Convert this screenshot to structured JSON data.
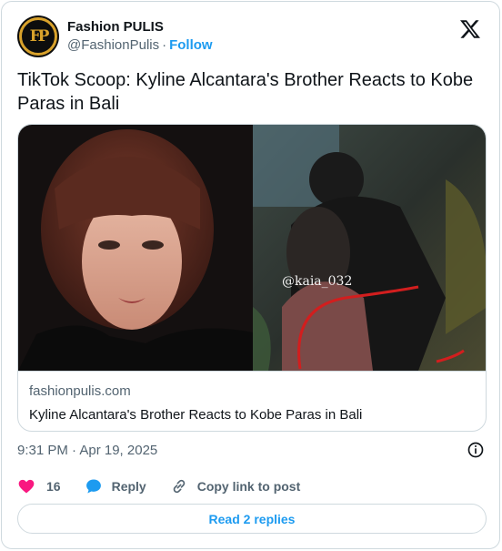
{
  "author": {
    "name": "Fashion PULIS",
    "handle": "@FashionPulis",
    "separator": "·",
    "follow_label": "Follow",
    "avatar_letters": "FP"
  },
  "tweet": {
    "text": "TikTok Scoop: Kyline Alcantara's Brother Reacts to Kobe Paras in Bali"
  },
  "link_card": {
    "domain": "fashionpulis.com",
    "title": "Kyline Alcantara's Brother Reacts to Kobe Paras in Bali",
    "watermark": "@kaia_032"
  },
  "meta": {
    "timestamp": "9:31 PM · Apr 19, 2025"
  },
  "actions": {
    "likes": "16",
    "reply_label": "Reply",
    "copy_label": "Copy link to post"
  },
  "replies_button": "Read 2 replies",
  "colors": {
    "accent": "#1d9bf0",
    "like": "#f91880",
    "avatar_gold": "#d9a22b"
  }
}
